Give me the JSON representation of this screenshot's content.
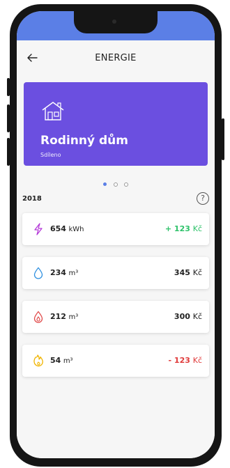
{
  "header": {
    "title": "ENERGIE"
  },
  "property_card": {
    "name": "Rodinný dům",
    "subtitle": "Sdíleno"
  },
  "carousel": {
    "dots": 3,
    "active": 0
  },
  "section": {
    "year": "2018",
    "help": "?"
  },
  "items": [
    {
      "icon": "lightning-icon",
      "value": "654",
      "unit": "kWh",
      "price_prefix": "+ ",
      "price": "123",
      "currency": "Kč",
      "tone": "positive"
    },
    {
      "icon": "water-drop-icon",
      "value": "234",
      "unit": "m³",
      "price_prefix": "",
      "price": "345",
      "currency": "Kč",
      "tone": "neutral"
    },
    {
      "icon": "flame-icon",
      "value": "212",
      "unit": "m³",
      "price_prefix": "",
      "price": "300",
      "currency": "Kč",
      "tone": "neutral"
    },
    {
      "icon": "gas-icon",
      "value": "54",
      "unit": "m³",
      "price_prefix": "- ",
      "price": "123",
      "currency": "Kč",
      "tone": "negative"
    }
  ],
  "colors": {
    "accent": "#5b7fe6",
    "card": "#6b4fe0",
    "positive": "#2ec26a",
    "negative": "#e03b3b"
  }
}
